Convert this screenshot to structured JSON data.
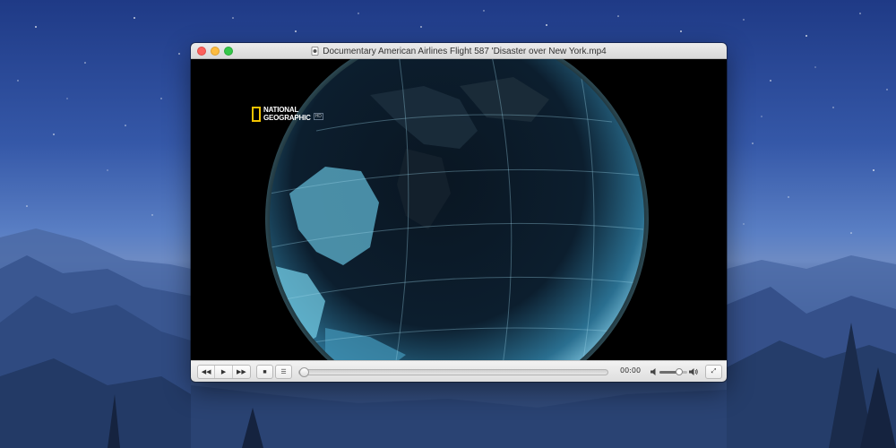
{
  "window": {
    "title": "Documentary American Airlines Flight 587 'Disaster over New York.mp4"
  },
  "video": {
    "logo_lines": [
      "NATIONAL",
      "GEOGRAPHIC"
    ],
    "logo_badge": "HD",
    "logo_color": "#f2c200"
  },
  "controls": {
    "rewind_icon": "◀◀",
    "play_icon": "▶",
    "forward_icon": "▶▶",
    "stop_icon": "■",
    "playlist_icon": "☰",
    "fullscreen_icon": "⤢",
    "time": "00:00",
    "progress": 0.0,
    "volume": 0.7
  },
  "colors": {
    "close": "#fc605c",
    "minimize": "#fdbc40",
    "zoom": "#34c84a"
  }
}
